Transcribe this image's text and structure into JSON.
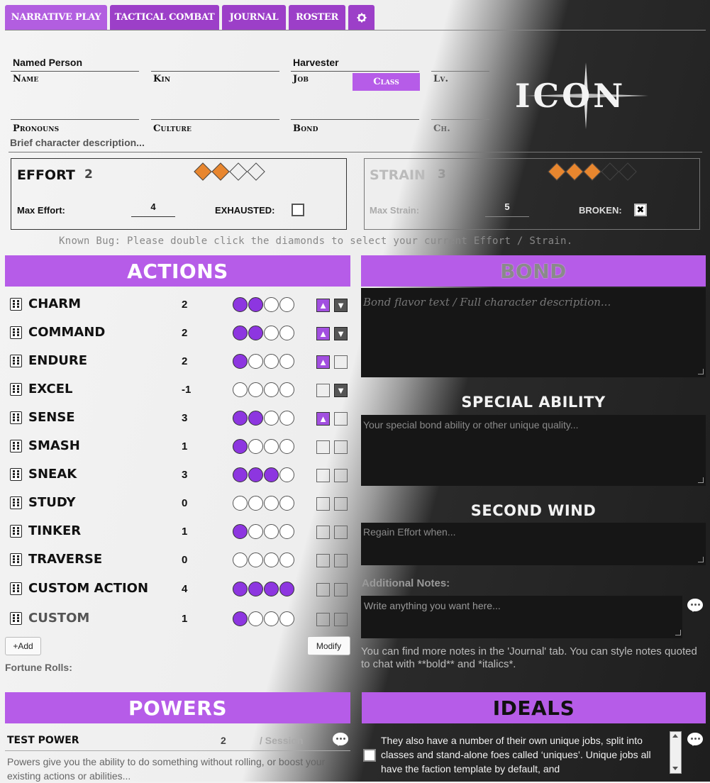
{
  "tabs": [
    {
      "label": "NARRATIVE PLAY"
    },
    {
      "label": "TACTICAL COMBAT"
    },
    {
      "label": "JOURNAL"
    },
    {
      "label": "ROSTER"
    }
  ],
  "settings_icon": "gear-icon",
  "character": {
    "name_value": "Named Person",
    "name_label": "Name",
    "kin_value": "",
    "kin_label": "Kin",
    "job_value": "Harvester",
    "job_label": "Job",
    "class_button": "Class",
    "level_label": "Lv.",
    "ch_label": "Ch.",
    "pronouns_label": "Pronouns",
    "culture_label": "Culture",
    "bond_label": "Bond",
    "description_placeholder": "Brief character description..."
  },
  "logo_text": "ICON",
  "effort": {
    "label": "EFFORT",
    "value": "2",
    "filled": 2,
    "total": 4,
    "max_label": "Max Effort:",
    "max_value": "4",
    "exhausted_label": "EXHAUSTED:"
  },
  "strain": {
    "label": "STRAIN",
    "value": "3",
    "filled": 3,
    "total": 5,
    "max_label": "Max Strain:",
    "max_value": "5",
    "broken_label": "BROKEN:",
    "broken_mark": "✖"
  },
  "bug_notice": "Known Bug: Please double click the diamonds to select your current Effort / Strain.",
  "actions": {
    "title": "ACTIONS",
    "items": [
      {
        "name": "CHARM",
        "value": "2",
        "filled": 2,
        "up": true,
        "down": true
      },
      {
        "name": "COMMAND",
        "value": "2",
        "filled": 2,
        "up": true,
        "down": true
      },
      {
        "name": "ENDURE",
        "value": "2",
        "filled": 1,
        "up": true,
        "down": false
      },
      {
        "name": "EXCEL",
        "value": "-1",
        "filled": 0,
        "up": false,
        "down": true
      },
      {
        "name": "SENSE",
        "value": "3",
        "filled": 2,
        "up": true,
        "down": false
      },
      {
        "name": "SMASH",
        "value": "1",
        "filled": 1,
        "up": false,
        "down": false
      },
      {
        "name": "SNEAK",
        "value": "3",
        "filled": 3,
        "up": false,
        "down": false
      },
      {
        "name": "STUDY",
        "value": "0",
        "filled": 0,
        "up": false,
        "down": false
      },
      {
        "name": "TINKER",
        "value": "1",
        "filled": 1,
        "up": false,
        "down": false
      },
      {
        "name": "TRAVERSE",
        "value": "0",
        "filled": 0,
        "up": false,
        "down": false
      },
      {
        "name": "CUSTOM ACTION",
        "value": "4",
        "filled": 4,
        "up": false,
        "down": false
      },
      {
        "name": "CUSTOM",
        "value": "1",
        "filled": 1,
        "up": false,
        "down": false
      }
    ],
    "add_button": "+Add",
    "modify_button": "Modify",
    "fortune_label": "Fortune Rolls:"
  },
  "bond": {
    "title": "BOND",
    "flavor_placeholder": "Bond flavor text / Full character description...",
    "special_title": "SPECIAL ABILITY",
    "special_placeholder": "Your special bond ability or other unique quality...",
    "second_wind_title": "SECOND WIND",
    "second_wind_placeholder": "Regain Effort when...",
    "notes_label": "Additional Notes:",
    "notes_placeholder": "Write anything you want here...",
    "notes_hint": "You can find more notes in the 'Journal' tab. You can style notes quoted to chat with **bold** and *italics*."
  },
  "powers": {
    "title": "POWERS",
    "item_name": "TEST POWER",
    "item_count": "2",
    "item_per": "/ Session",
    "description": "Powers give you the ability to do something without rolling, or boost your existing actions or abilities..."
  },
  "ideals": {
    "title": "IDEALS",
    "text": "They also have a number of their own unique jobs, split into classes and stand-alone foes called ‘uniques’. Unique jobs all have the faction template by default, and"
  },
  "colors": {
    "accent": "#b65ce8",
    "tab": "#9c3fc8",
    "diamond_fill": "#e8862e",
    "dot_fill": "#8d36e0"
  }
}
